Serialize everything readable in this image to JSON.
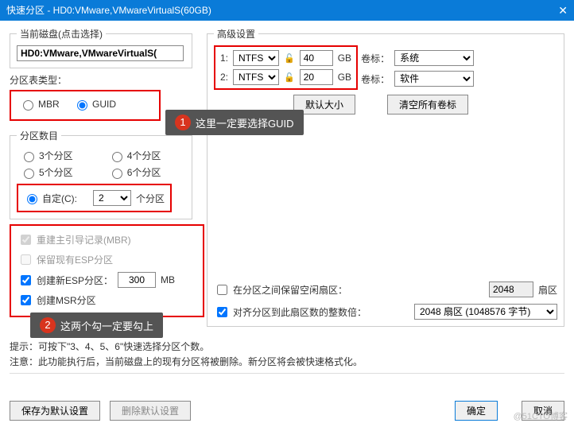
{
  "window": {
    "title": "快速分区 - HD0:VMware,VMwareVirtualS(60GB)"
  },
  "current_disk": {
    "legend": "当前磁盘(点击选择)",
    "value": "HD0:VMware,VMwareVirtualS("
  },
  "advanced": {
    "legend": "高级设置",
    "rows": [
      {
        "idx": "1:",
        "fs": "NTFS",
        "size": "40",
        "unit": "GB",
        "vlabel": "卷标：",
        "vol": "系统"
      },
      {
        "idx": "2:",
        "fs": "NTFS",
        "size": "20",
        "unit": "GB",
        "vlabel": "卷标：",
        "vol": "软件"
      }
    ],
    "default_btn": "默认大小",
    "clear_btn": "清空所有卷标"
  },
  "table_type": {
    "legend": "分区表类型：",
    "mbr": "MBR",
    "guid": "GUID"
  },
  "callout1": "这里一定要选择GUID",
  "count": {
    "legend": "分区数目",
    "opts": {
      "p3": "3个分区",
      "p4": "4个分区",
      "p5": "5个分区",
      "p6": "6个分区"
    },
    "custom": "自定(C):",
    "custom_val": "2",
    "custom_suffix": "个分区"
  },
  "options": {
    "mbr_rebuild": "重建主引导记录(MBR)",
    "keep_esp": "保留现有ESP分区",
    "new_esp": "创建新ESP分区：",
    "esp_size": "300",
    "esp_unit": "MB",
    "msr": "创建MSR分区"
  },
  "callout2": "这两个勾一定要勾上",
  "extras": {
    "reserve": "在分区之间保留空闲扇区：",
    "reserve_val": "2048",
    "reserve_unit": "扇区",
    "align": "对齐分区到此扇区数的整数倍：",
    "align_val": "2048 扇区 (1048576 字节)"
  },
  "tips": {
    "t1": "提示：可按下\"3、4、5、6\"快速选择分区个数。",
    "t2": "注意：此功能执行后，当前磁盘上的现有分区将被删除。新分区将会被快速格式化。"
  },
  "buttons": {
    "save": "保存为默认设置",
    "del": "删除默认设置",
    "ok": "确定",
    "cancel": "取消"
  },
  "watermark": "@51CTO博客"
}
